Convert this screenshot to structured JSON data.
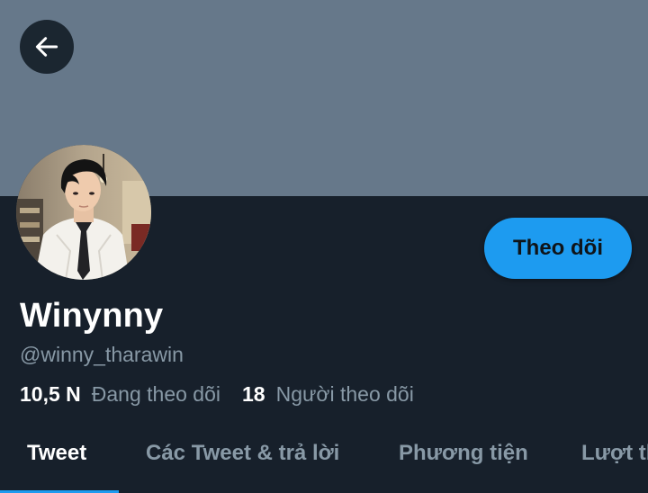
{
  "header": {
    "back_icon": "arrow-left-icon",
    "banner_color": "#66788a"
  },
  "profile": {
    "avatar_alt": "profile photo",
    "follow_label": "Theo dõi",
    "display_name": "Winynny",
    "handle": "@winny_tharawin"
  },
  "stats": [
    {
      "value": "10,5 N",
      "label": "Đang theo dõi"
    },
    {
      "value": "18",
      "label": "Người theo dõi"
    }
  ],
  "tabs": [
    {
      "label": "Tweet",
      "active": true
    },
    {
      "label": "Các Tweet & trả lời",
      "active": false
    },
    {
      "label": "Phương tiện",
      "active": false
    },
    {
      "label": "Lượt thích",
      "active": false
    }
  ],
  "colors": {
    "accent": "#1d9bf0",
    "background": "#15202b",
    "secondary_text": "#8899a6"
  }
}
